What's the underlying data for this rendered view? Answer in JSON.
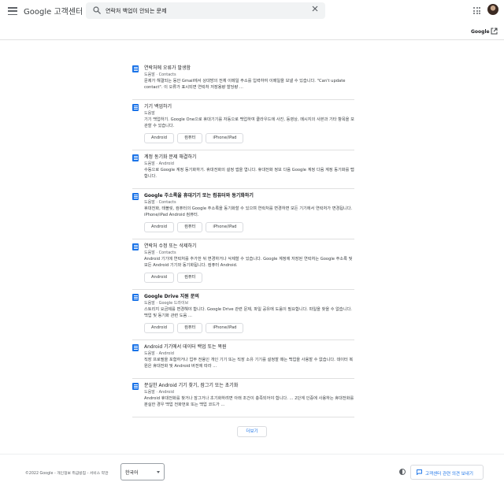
{
  "header": {
    "brand": "Google 고객센터",
    "search_value": "연락처 백업이 안되는 문제",
    "google_link": "Google"
  },
  "results": [
    {
      "title": "연락처에 오류가 발생함",
      "bold_title": false,
      "source": "도움말 · Contacts",
      "snippet": "문제가 해결되는 동안 Gmail에서 상대방의 전체 이메일 주소를 입력하여 이메일을 보낼 수 있습니다. \"Can't update contact\". 이 오류가 표시되면 연락처 저장용량 할당량 ...",
      "chips": []
    },
    {
      "title": "기기 백업하기",
      "bold_title": false,
      "source": "도움말",
      "snippet": "기기 백업하기. Google One으로 휴대기기를 자동으로 백업하여 클라우드에 사진, 동영상, 메시지의 사본과 기타 항목을 보관할 수 있습니다.",
      "chips": [
        "Android",
        "컴퓨터",
        "iPhone/iPad"
      ]
    },
    {
      "title": "계정 동기화 문제 해결하기",
      "bold_title": false,
      "source": "도움말 · Android",
      "snippet": "수동으로 Google 계정 동기화하기. 휴대전화의 설정 앱을 엽니다. 휴대전화 정보 다음 Google 계정 다음 계정 동기화를 탭합니다.",
      "chips": []
    },
    {
      "title": "Google 주소록을 휴대기기 또는 컴퓨터와 동기화하기",
      "bold_title": true,
      "source": "도움말 · Contacts",
      "snippet": "휴대전화, 태블릿, 컴퓨터의 Google 주소록을 동기화할 수 있으며 연락처를 변경하면 모든 기기에서 연락처가 변경됩니다. iPhone/iPad Android 컴퓨터.",
      "chips": [
        "Android",
        "컴퓨터",
        "iPhone/iPad"
      ]
    },
    {
      "title": "연락처 수정 또는 삭제하기",
      "bold_title": false,
      "source": "도움말 · Contacts",
      "snippet": "Android 기기에 연락처를 추가한 뒤 변경하거나 삭제할 수 있습니다. Google 계정에 저장된 연락처는 Google 주소록 및 모든 Android 기기와 동기화됩니다. 컴퓨터 Android.",
      "chips": [
        "Android",
        "컴퓨터"
      ]
    },
    {
      "title": "Google Drive 지원 문의",
      "bold_title": true,
      "source": "도움말 · Google 드라이브",
      "snippet": "스토리지 요금제를 변경해야 합니다. Google Drive 관련 문제, 파일 공유에 도움이 필요합니다. 파일을 찾을 수 없습니다. 백업 및 동기화 관련 도움 ...",
      "chips": [
        "Android",
        "컴퓨터",
        "iPhone/iPad"
      ]
    },
    {
      "title": "Android 기기에서 데이터 백업 또는 복원",
      "bold_title": false,
      "source": "도움말 · Android",
      "snippet": "직장 프로필을 포함하거나 업무 전용인 개인 기기 또는 직장 소유 기기를 설정할 때는 백업을 사용할 수 없습니다. 데이터 복원은 휴대전화 및 Android 버전에 따라 ...",
      "chips": []
    },
    {
      "title": "분실한 Android 기기 찾기, 잠그기 또는 초기화",
      "bold_title": false,
      "source": "도움말 · Android",
      "snippet": "Android 휴대전화를 찾거나 잠그거나 초기화하려면 아래 조건이 충족되어야 합니다. ... 2단계 인증에 사용하는 휴대전화를 분실한 경우 백업 전화번호 또는 백업 코드가 ...",
      "chips": []
    }
  ],
  "more_label": "더보기",
  "footer": {
    "copyright": "©2022 Google",
    "privacy": "개인정보 취급방침",
    "terms": "서비스 약관",
    "language": "한국어",
    "feedback_label": "고객센터 관련 의견 보내기"
  },
  "colors": {
    "accent": "#1a73e8",
    "text": "#202124",
    "muted": "#5f6368",
    "border": "#dadce0"
  }
}
